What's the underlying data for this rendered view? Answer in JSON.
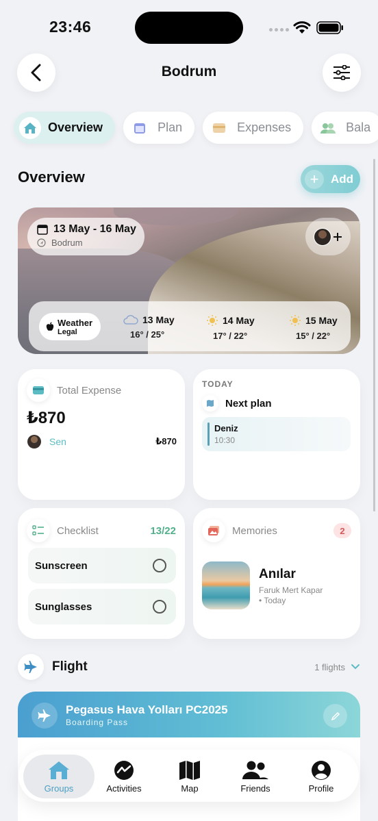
{
  "status_bar": {
    "time": "23:46"
  },
  "header": {
    "title": "Bodrum"
  },
  "tabs": [
    {
      "label": "Overview",
      "icon": "house-icon",
      "active": true
    },
    {
      "label": "Plan",
      "icon": "calendar-icon",
      "active": false
    },
    {
      "label": "Expenses",
      "icon": "card-icon",
      "active": false
    },
    {
      "label": "Bala",
      "icon": "people-icon",
      "active": false
    }
  ],
  "overview": {
    "title": "Overview",
    "add_label": "Add"
  },
  "hero": {
    "date_range": "13 May - 16 May",
    "location": "Bodrum",
    "weather_title": "Weather",
    "weather_source": "Legal",
    "forecast": [
      {
        "date": "13 May",
        "temps": "16° / 25°",
        "icon": "cloud-icon"
      },
      {
        "date": "14 May",
        "temps": "17° / 22°",
        "icon": "sun-icon"
      },
      {
        "date": "15 May",
        "temps": "15° / 22°",
        "icon": "sun-icon"
      }
    ]
  },
  "expense": {
    "title": "Total Expense",
    "total": "₺870",
    "person": "Sen",
    "person_amount": "₺870"
  },
  "plan": {
    "today_label": "TODAY",
    "next_label": "Next plan",
    "item_title": "Deniz",
    "item_time": "10:30"
  },
  "checklist": {
    "title": "Checklist",
    "count": "13/22",
    "items": [
      {
        "label": "Sunscreen"
      },
      {
        "label": "Sunglasses"
      }
    ]
  },
  "memories": {
    "title": "Memories",
    "badge": "2",
    "album_title": "Anılar",
    "author": "Faruk Mert Kapar",
    "when": "• Today"
  },
  "flight": {
    "title": "Flight",
    "count": "1 flights",
    "pass_title": "Pegasus Hava Yolları PC2025",
    "pass_subtitle": "Boarding Pass"
  },
  "tabbar": [
    {
      "label": "Groups",
      "icon": "groups-icon",
      "active": true
    },
    {
      "label": "Activities",
      "icon": "activities-icon",
      "active": false
    },
    {
      "label": "Map",
      "icon": "map-icon",
      "active": false
    },
    {
      "label": "Friends",
      "icon": "friends-icon",
      "active": false
    },
    {
      "label": "Profile",
      "icon": "profile-icon",
      "active": false
    }
  ],
  "colors": {
    "accent": "#4a9fc4",
    "teal": "#7fcdd3",
    "green": "#52b08b",
    "badge_red": "#d45858"
  }
}
